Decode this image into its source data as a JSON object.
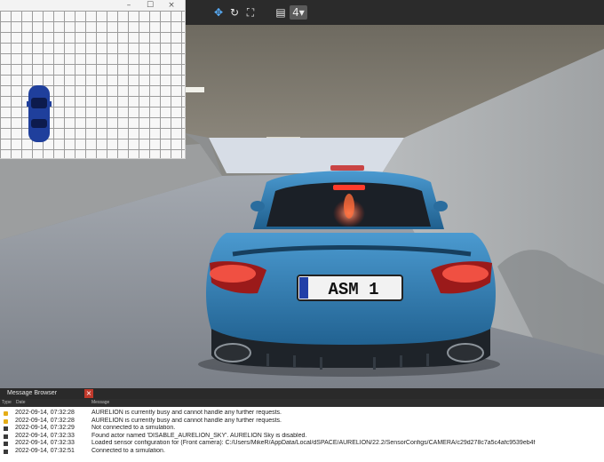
{
  "window": {
    "controls": {
      "minimize": "–",
      "maximize": "☐",
      "close": "×"
    }
  },
  "toolbar": {
    "buttons": [
      {
        "icon": "move-icon",
        "glyph": "✥"
      },
      {
        "icon": "refresh-icon",
        "glyph": "↻"
      },
      {
        "icon": "fullscreen-icon",
        "glyph": "⛶"
      },
      {
        "icon": "save-icon",
        "glyph": "▤"
      },
      {
        "icon": "layout-menu-icon",
        "glyph": "4▾"
      }
    ]
  },
  "viewport": {
    "license_plate": "ASM 1",
    "car_color": "#3a86b8"
  },
  "message_browser": {
    "title": "Message Browser",
    "close_glyph": "×",
    "columns": {
      "type": "Type",
      "date": "Date",
      "message": "Message"
    },
    "rows": [
      {
        "type": "warning",
        "date": "2022-09-14, 07:32:28",
        "message": "AURELION is currently busy and cannot handle any further requests."
      },
      {
        "type": "warning",
        "date": "2022-09-14, 07:32:28",
        "message": "AURELION is currently busy and cannot handle any further requests."
      },
      {
        "type": "info",
        "date": "2022-09-14, 07:32:29",
        "message": "Not connected to a simulation."
      },
      {
        "type": "info",
        "date": "2022-09-14, 07:32:33",
        "message": "Found actor named 'DISABLE_AURELION_SKY'. AURELION Sky is disabled."
      },
      {
        "type": "info",
        "date": "2022-09-14, 07:32:33",
        "message": "Loaded sensor configuration for (Front camera): C:/Users/MikeR/AppData/Local/dSPACE/AURELION/22.2/SensorConfigs/CAMERA/c29d278c7a5c4afc9539eb4f"
      },
      {
        "type": "info",
        "date": "2022-09-14, 07:32:51",
        "message": "Connected to a simulation."
      }
    ]
  },
  "colors": {
    "warning": "#e5ad16",
    "close_red": "#c0392b",
    "panel_dark": "#2a2a2a"
  }
}
